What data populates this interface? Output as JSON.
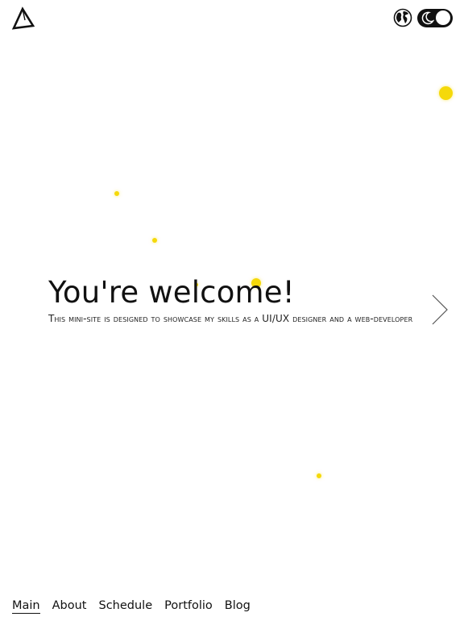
{
  "header": {
    "logo_icon": "triangle-logo-icon",
    "language_icon": "globe-icon",
    "theme_toggle": {
      "icon": "moon-icon",
      "mode": "dark-toggle"
    }
  },
  "hero": {
    "title": "You're welcome!",
    "subtitle": "This mini-site is designed to showcase my skills as a UI/UX designer and a web-developer"
  },
  "next_icon": "chevron-right-icon",
  "nav": {
    "items": [
      {
        "label": "Main",
        "active": true
      },
      {
        "label": "About",
        "active": false
      },
      {
        "label": "Schedule",
        "active": false
      },
      {
        "label": "Portfolio",
        "active": false
      },
      {
        "label": "Blog",
        "active": false
      }
    ]
  },
  "colors": {
    "accent": "#f5d90a",
    "text": "#111111",
    "background": "#ffffff"
  }
}
